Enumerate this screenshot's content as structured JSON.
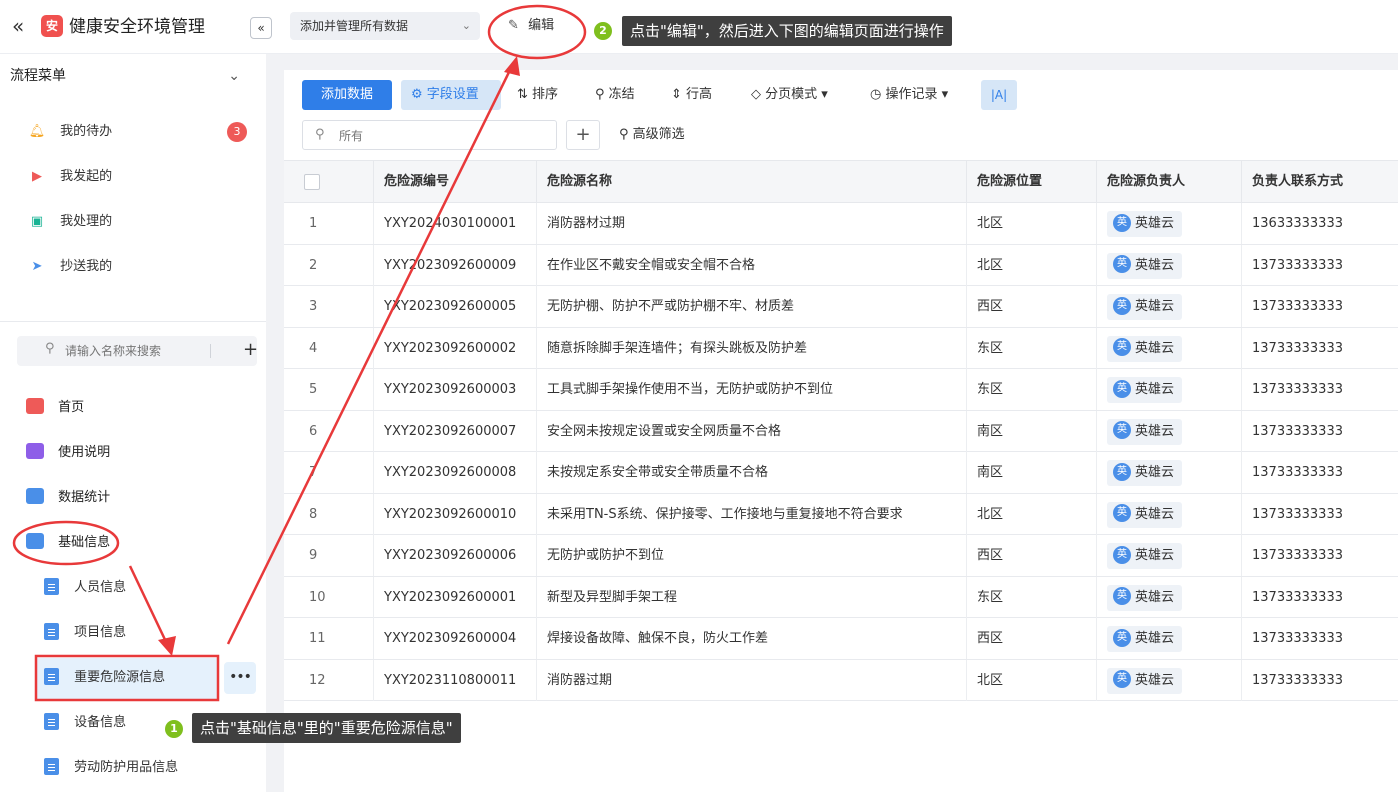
{
  "app": {
    "title": "健康安全环境管理",
    "logo_text": "安"
  },
  "topbar": {
    "data_select_value": "添加并管理所有数据",
    "edit_label": "编辑"
  },
  "sidebar": {
    "flow_header": "流程菜单",
    "flow_items": [
      {
        "label": "我的待办",
        "badge": "3",
        "icon": "bell-icon",
        "color": "#f5a623"
      },
      {
        "label": "我发起的",
        "icon": "play-icon",
        "color": "#ee5a58"
      },
      {
        "label": "我处理的",
        "icon": "inbox-icon",
        "color": "#1ab394"
      },
      {
        "label": "抄送我的",
        "icon": "send-icon",
        "color": "#4a8fe8"
      }
    ],
    "search_placeholder": "请输入名称来搜索",
    "nav_items": [
      {
        "label": "首页",
        "icon": "bank-icon",
        "color": "#ee5a58"
      },
      {
        "label": "使用说明",
        "icon": "chart-icon",
        "color": "#8e5ee8"
      },
      {
        "label": "数据统计",
        "icon": "folder-icon",
        "color": "#4a8fe8"
      },
      {
        "label": "基础信息",
        "icon": "folder-open-icon",
        "color": "#4a8fe8"
      }
    ],
    "sub_items": [
      "人员信息",
      "项目信息",
      "重要危险源信息",
      "设备信息",
      "劳动防护用品信息"
    ]
  },
  "toolbar": {
    "add_data": "添加数据",
    "field_settings": "字段设置",
    "sort": "排序",
    "freeze": "冻结",
    "row_height": "行高",
    "paging_mode": "分页模式",
    "operation_log": "操作记录",
    "font_toggle": "|A|",
    "filter_placeholder": "所有",
    "advanced_filter": "高级筛选"
  },
  "table": {
    "headers": [
      "危险源编号",
      "危险源名称",
      "危险源位置",
      "危险源负责人",
      "负责人联系方式"
    ],
    "rows": [
      {
        "idx": "1",
        "code": "YXY2024030100001",
        "name": "消防器材过期",
        "location": "北区",
        "owner": "英雄云",
        "phone": "13633333333"
      },
      {
        "idx": "2",
        "code": "YXY2023092600009",
        "name": "在作业区不戴安全帽或安全帽不合格",
        "location": "北区",
        "owner": "英雄云",
        "phone": "13733333333"
      },
      {
        "idx": "3",
        "code": "YXY2023092600005",
        "name": "无防护棚、防护不严或防护棚不牢、材质差",
        "location": "西区",
        "owner": "英雄云",
        "phone": "13733333333"
      },
      {
        "idx": "4",
        "code": "YXY2023092600002",
        "name": "随意拆除脚手架连墙件；有探头跳板及防护差",
        "location": "东区",
        "owner": "英雄云",
        "phone": "13733333333"
      },
      {
        "idx": "5",
        "code": "YXY2023092600003",
        "name": "工具式脚手架操作使用不当，无防护或防护不到位",
        "location": "东区",
        "owner": "英雄云",
        "phone": "13733333333"
      },
      {
        "idx": "6",
        "code": "YXY2023092600007",
        "name": "安全网未按规定设置或安全网质量不合格",
        "location": "南区",
        "owner": "英雄云",
        "phone": "13733333333"
      },
      {
        "idx": "7",
        "code": "YXY2023092600008",
        "name": "未按规定系安全带或安全带质量不合格",
        "location": "南区",
        "owner": "英雄云",
        "phone": "13733333333"
      },
      {
        "idx": "8",
        "code": "YXY2023092600010",
        "name": "未采用TN-S系统、保护接零、工作接地与重复接地不符合要求",
        "location": "北区",
        "owner": "英雄云",
        "phone": "13733333333"
      },
      {
        "idx": "9",
        "code": "YXY2023092600006",
        "name": "无防护或防护不到位",
        "location": "西区",
        "owner": "英雄云",
        "phone": "13733333333"
      },
      {
        "idx": "10",
        "code": "YXY2023092600001",
        "name": "新型及异型脚手架工程",
        "location": "东区",
        "owner": "英雄云",
        "phone": "13733333333"
      },
      {
        "idx": "11",
        "code": "YXY2023092600004",
        "name": "焊接设备故障、触保不良，防火工作差",
        "location": "西区",
        "owner": "英雄云",
        "phone": "13733333333"
      },
      {
        "idx": "12",
        "code": "YXY2023110800011",
        "name": "消防器过期",
        "location": "北区",
        "owner": "英雄云",
        "phone": "13733333333"
      }
    ],
    "owner_avatar_text": "英"
  },
  "annotations": {
    "step1_num": "1",
    "step1_text": "点击\"基础信息\"里的\"重要危险源信息\"",
    "step2_num": "2",
    "step2_text": "点击\"编辑\"，然后进入下图的编辑页面进行操作",
    "color": "#e8393a"
  }
}
